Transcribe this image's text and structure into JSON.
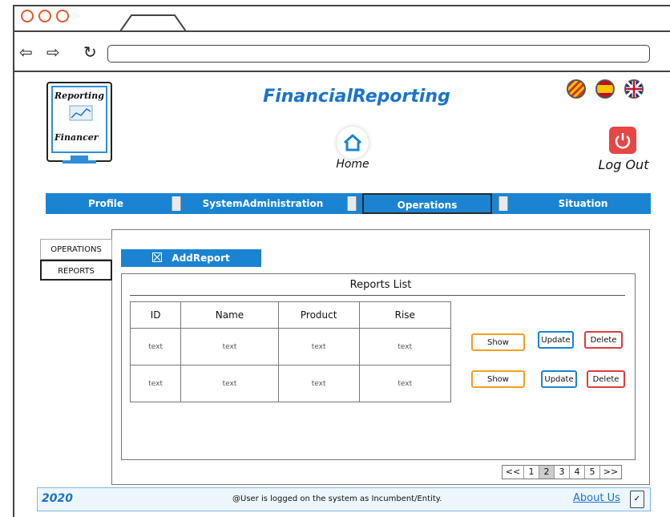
{
  "browser": {
    "icons": {
      "back": "arrow-left-icon",
      "forward": "arrow-right-icon",
      "refresh": "refresh-icon"
    }
  },
  "logo": {
    "line1": "Reporting",
    "line2": "Financer"
  },
  "header": {
    "title": "FinancialReporting",
    "home_label": "Home",
    "logout_label": "Log Out",
    "flags": [
      "catalan-flag-icon",
      "spanish-flag-icon",
      "uk-flag-icon"
    ]
  },
  "menu": {
    "items": [
      {
        "label": "Profile"
      },
      {
        "label": "SystemAdministration"
      },
      {
        "label": "Operations",
        "active": true
      },
      {
        "label": "Situation"
      }
    ]
  },
  "side_tabs": [
    {
      "label": "OPERATIONS"
    },
    {
      "label": "REPORTS",
      "selected": true
    }
  ],
  "toolbar": {
    "add_report_label": "AddReport"
  },
  "reports_list": {
    "title": "Reports List",
    "columns": [
      "ID",
      "Name",
      "Product",
      "Rise"
    ],
    "rows": [
      [
        "text",
        "text",
        "text",
        "text"
      ],
      [
        "text",
        "text",
        "text",
        "text"
      ]
    ],
    "actions": {
      "show": "Show",
      "update": "Update",
      "delete": "Delete"
    }
  },
  "pagination": {
    "first": "<<",
    "pages": [
      "1",
      "2",
      "3",
      "4",
      "5"
    ],
    "current": "2",
    "last": ">>"
  },
  "footer": {
    "year": "2020",
    "message": "@User is logged on the system as Incumbent/Entity.",
    "about": "About Us"
  },
  "colors": {
    "accent": "#1a84d2",
    "show": "#f0a020",
    "update": "#1a84d2",
    "delete": "#e03b3b",
    "logout": "#e84545"
  }
}
